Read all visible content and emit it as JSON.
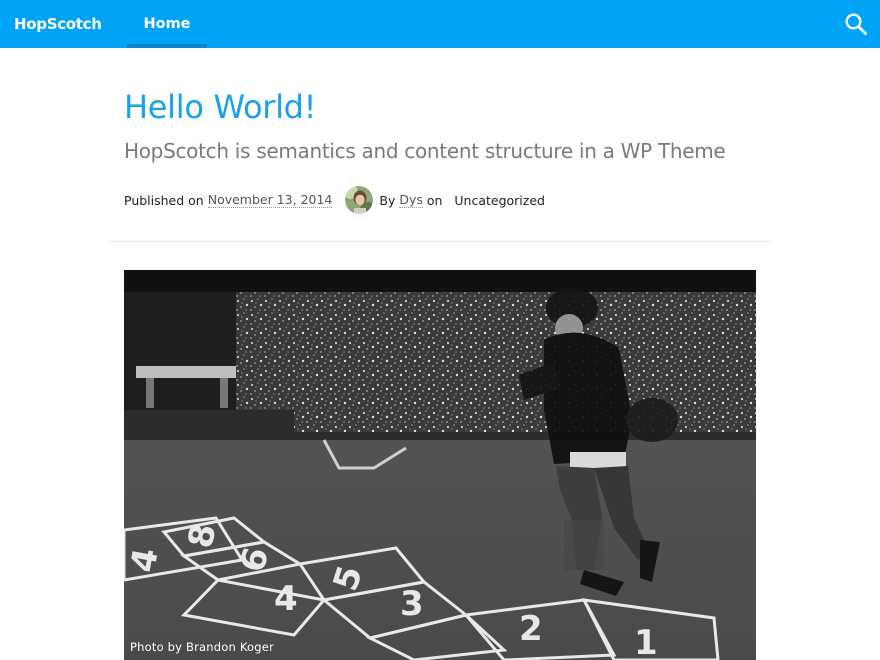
{
  "header": {
    "brand": "HopScotch",
    "nav": [
      {
        "label": "Home",
        "active": true
      }
    ],
    "search_icon": "search-icon",
    "bar_color": "#00a3f5"
  },
  "post": {
    "title": "Hello World!",
    "subtitle": "HopScotch is semantics and content structure in a WP Theme",
    "meta": {
      "published_prefix": "Published on",
      "date": "November 13, 2014",
      "by_prefix": "By",
      "author": "Dys",
      "on_label": "on",
      "category": "Uncategorized"
    },
    "image_caption": "Photo by Brandon Koger",
    "title_color": "#1ba1ea"
  }
}
